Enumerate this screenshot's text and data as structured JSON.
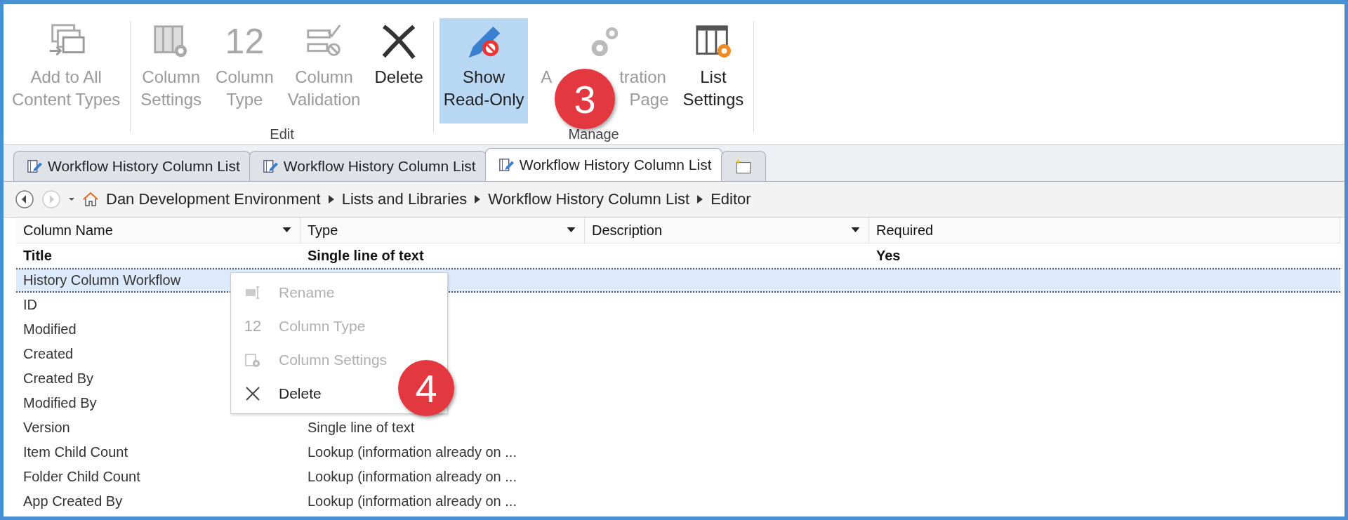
{
  "ribbon": {
    "groups": [
      {
        "buttons": [
          {
            "lines": [
              "Add to All",
              "Content Types"
            ],
            "disabled": true,
            "selected": false
          }
        ]
      },
      {
        "label": "Edit",
        "buttons": [
          {
            "lines": [
              "Column",
              "Settings"
            ],
            "disabled": true,
            "selected": false
          },
          {
            "lines": [
              "Column",
              "Type"
            ],
            "icon_text": "12",
            "disabled": true,
            "selected": false
          },
          {
            "lines": [
              "Column",
              "Validation"
            ],
            "disabled": true,
            "selected": false
          },
          {
            "lines": [
              "Delete"
            ],
            "disabled": false,
            "selected": false
          }
        ]
      },
      {
        "label": "Manage",
        "buttons": [
          {
            "lines": [
              "Show",
              "Read-Only"
            ],
            "disabled": false,
            "selected": true
          },
          {
            "lines": [
              "A",
              "Page"
            ],
            "tail": "tration",
            "disabled": true,
            "selected": false
          },
          {
            "lines": [
              "List",
              "Settings"
            ],
            "disabled": false,
            "selected": false
          }
        ]
      }
    ]
  },
  "callouts": [
    "3",
    "4"
  ],
  "tabs": [
    {
      "label": "Workflow History Column List",
      "selected": false
    },
    {
      "label": "Workflow History Column List",
      "selected": false
    },
    {
      "label": "Workflow History Column List",
      "selected": true
    }
  ],
  "breadcrumb": [
    "Dan Development Environment",
    "Lists and Libraries",
    "Workflow History Column List",
    "Editor"
  ],
  "table": {
    "columns": [
      "Column Name",
      "Type",
      "Description",
      "Required"
    ],
    "rows": [
      {
        "cells": [
          "Title",
          "Single line of text",
          "",
          "Yes"
        ],
        "selected": false,
        "bold": true
      },
      {
        "cells": [
          "History Column Workflow",
          "",
          "",
          ""
        ],
        "selected": true,
        "bold": false
      },
      {
        "cells": [
          "ID",
          "",
          "",
          ""
        ],
        "selected": false,
        "bold": false
      },
      {
        "cells": [
          "Modified",
          "",
          "",
          ""
        ],
        "selected": false,
        "bold": false
      },
      {
        "cells": [
          "Created",
          "",
          "",
          ""
        ],
        "selected": false,
        "bold": false
      },
      {
        "cells": [
          "Created By",
          "",
          "",
          ""
        ],
        "selected": false,
        "bold": false
      },
      {
        "cells": [
          "Modified By",
          "",
          "",
          ""
        ],
        "selected": false,
        "bold": false
      },
      {
        "cells": [
          "Version",
          "Single line of text",
          "",
          ""
        ],
        "selected": false,
        "bold": false
      },
      {
        "cells": [
          "Item Child Count",
          "Lookup (information already on ...",
          "",
          ""
        ],
        "selected": false,
        "bold": false
      },
      {
        "cells": [
          "Folder Child Count",
          "Lookup (information already on ...",
          "",
          ""
        ],
        "selected": false,
        "bold": false
      },
      {
        "cells": [
          "App Created By",
          "Lookup (information already on ...",
          "",
          ""
        ],
        "selected": false,
        "bold": false
      }
    ]
  },
  "context_menu": [
    {
      "label": "Rename",
      "disabled": true
    },
    {
      "label": "Column Type",
      "disabled": true,
      "icon_text": "12"
    },
    {
      "label": "Column Settings",
      "disabled": true
    },
    {
      "label": "Delete",
      "disabled": false
    }
  ]
}
